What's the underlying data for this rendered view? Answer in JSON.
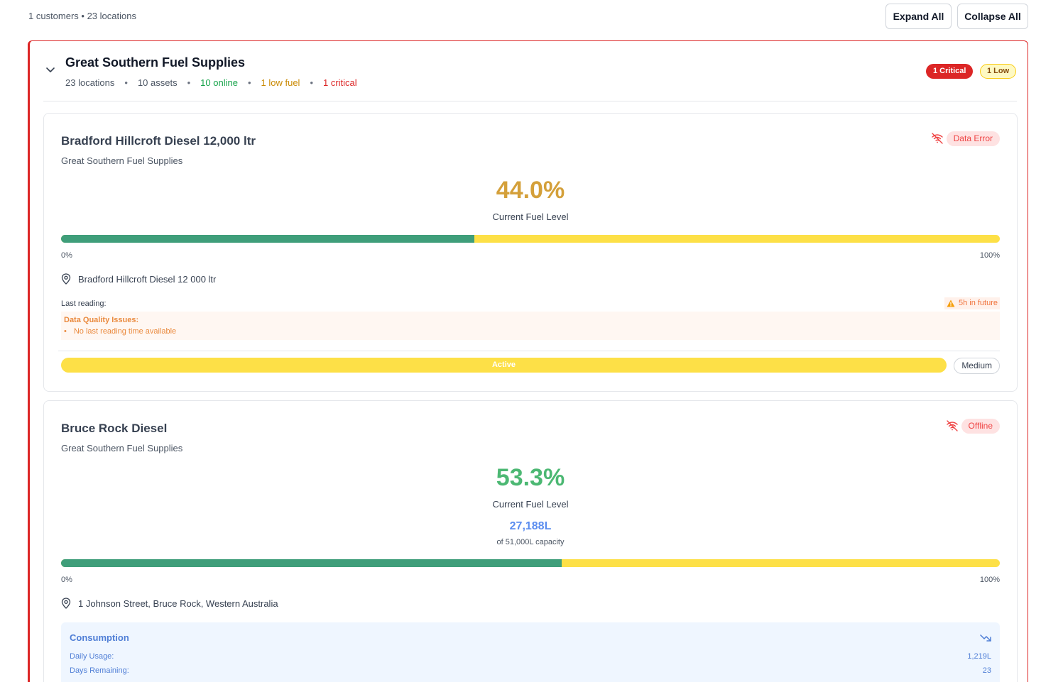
{
  "summary": "1 customers • 23 locations",
  "buttons": {
    "expand_all": "Expand All",
    "collapse_all": "Collapse All"
  },
  "customer": {
    "name": "Great Southern Fuel Supplies",
    "stats": {
      "locations": "23 locations",
      "assets": "10 assets",
      "online": "10 online",
      "low_fuel": "1 low fuel",
      "critical": "1 critical",
      "separator": "•"
    },
    "badges": {
      "critical": "1 Critical",
      "low": "1 Low"
    },
    "colors": {
      "critical": "#dc2626",
      "low": "#facc15",
      "online": "#16a34a"
    }
  },
  "assets": [
    {
      "title": "Bradford Hillcroft Diesel 12,000 ltr",
      "customer": "Great Southern Fuel Supplies",
      "status": "Data Error",
      "status_icon": "wifi-off-icon",
      "percent_text": "44.0%",
      "fuel_level_fraction": 0.44,
      "fuel_level_label": "Current Fuel Level",
      "scale_min": "0%",
      "scale_max": "100%",
      "location": "Bradford Hillcroft Diesel 12 000 ltr",
      "last_reading_label": "Last reading:",
      "future_warning": "5h in future",
      "data_quality_title": "Data Quality Issues:",
      "data_quality_items": [
        "No last reading time available"
      ],
      "activity_status": "Active",
      "priority": "Medium"
    },
    {
      "title": "Bruce Rock Diesel",
      "customer": "Great Southern Fuel Supplies",
      "status": "Offline",
      "status_icon": "wifi-off-icon",
      "percent_text": "53.3%",
      "fuel_level_fraction": 0.533,
      "fuel_level_label": "Current Fuel Level",
      "volume": "27,188L",
      "capacity": "of 51,000L capacity",
      "scale_min": "0%",
      "scale_max": "100%",
      "location": "1 Johnson Street, Bruce Rock, Western Australia",
      "consumption": {
        "title": "Consumption",
        "trend_icon": "trending-down-icon",
        "daily_usage_label": "Daily Usage:",
        "daily_usage_value": "1,219L",
        "days_remaining_label": "Days Remaining:",
        "days_remaining_value": "23"
      }
    }
  ]
}
